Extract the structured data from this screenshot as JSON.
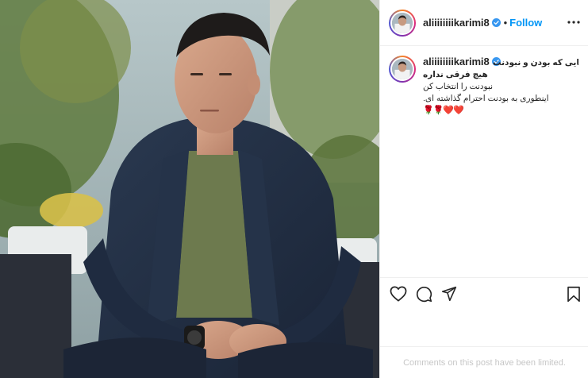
{
  "post": {
    "username": "aliiiiiiiikarimi8",
    "verified": true,
    "follow_label": "Follow",
    "separator": "•"
  },
  "caption": {
    "username": "aliiiiiiiikarimi8",
    "lines": [
      {
        "text": "جایی که بودن و نبودنت",
        "bold": true
      },
      {
        "text": "هیچ فرقی نداره",
        "bold": true
      },
      {
        "text": "نبودنت را انتخاب کن",
        "bold": false
      },
      {
        "text": ".اینطوری به بودنت احترام گذاشته ای",
        "bold": false
      }
    ],
    "emojis": "🌹🌹❤️❤️"
  },
  "actions": {
    "icons": [
      "heart-icon",
      "comment-icon",
      "share-icon",
      "bookmark-icon"
    ]
  },
  "footer": {
    "comments_limited": "Comments on this post have been limited."
  },
  "colors": {
    "accent": "#0095f6",
    "verified": "#3897f0",
    "muted": "#c7c7c7",
    "divider": "#efefef",
    "text": "#262626"
  }
}
